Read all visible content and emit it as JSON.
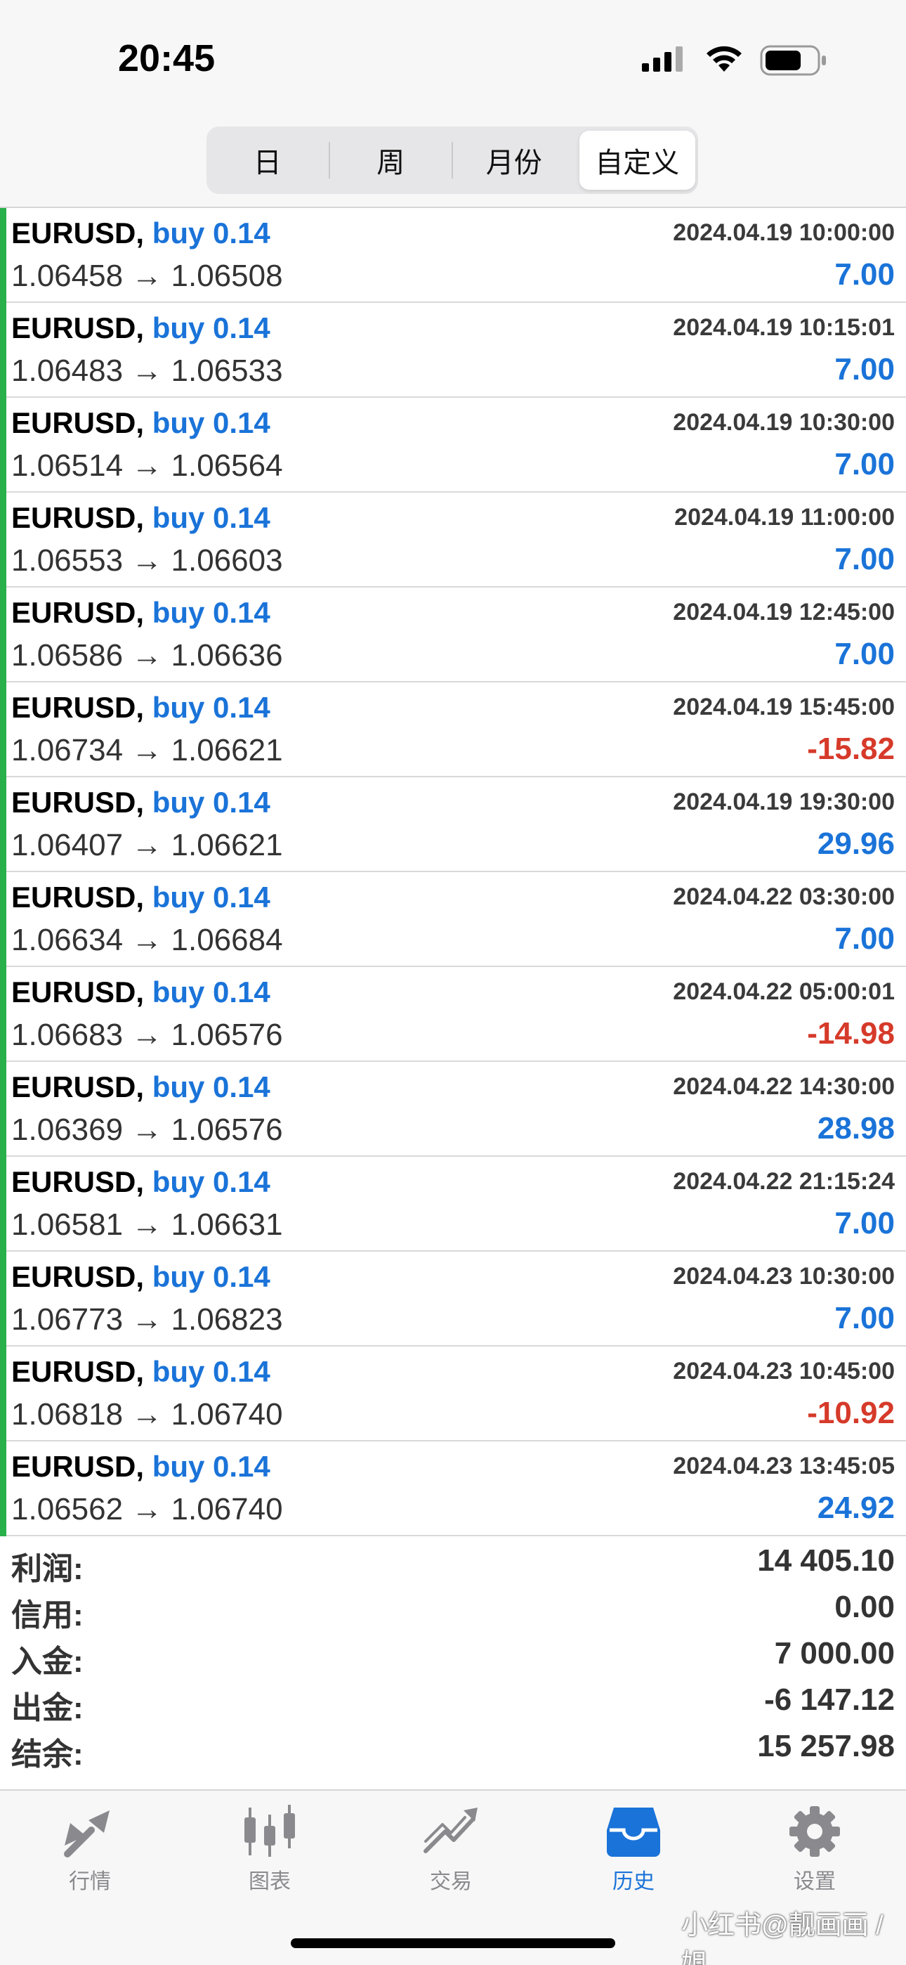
{
  "status": {
    "time": "20:45"
  },
  "segments": [
    {
      "label": "日",
      "active": false
    },
    {
      "label": "周",
      "active": false
    },
    {
      "label": "月份",
      "active": false
    },
    {
      "label": "自定义",
      "active": true
    }
  ],
  "trades": [
    {
      "symbol": "EURUSD,",
      "side": "buy 0.14",
      "time": "2024.04.19 10:00:00",
      "prices": "1.06458 → 1.06508",
      "profit": "7.00",
      "negative": false
    },
    {
      "symbol": "EURUSD,",
      "side": "buy 0.14",
      "time": "2024.04.19 10:15:01",
      "prices": "1.06483 → 1.06533",
      "profit": "7.00",
      "negative": false
    },
    {
      "symbol": "EURUSD,",
      "side": "buy 0.14",
      "time": "2024.04.19 10:30:00",
      "prices": "1.06514 → 1.06564",
      "profit": "7.00",
      "negative": false
    },
    {
      "symbol": "EURUSD,",
      "side": "buy 0.14",
      "time": "2024.04.19 11:00:00",
      "prices": "1.06553 → 1.06603",
      "profit": "7.00",
      "negative": false
    },
    {
      "symbol": "EURUSD,",
      "side": "buy 0.14",
      "time": "2024.04.19 12:45:00",
      "prices": "1.06586 → 1.06636",
      "profit": "7.00",
      "negative": false
    },
    {
      "symbol": "EURUSD,",
      "side": "buy 0.14",
      "time": "2024.04.19 15:45:00",
      "prices": "1.06734 → 1.06621",
      "profit": "-15.82",
      "negative": true
    },
    {
      "symbol": "EURUSD,",
      "side": "buy 0.14",
      "time": "2024.04.19 19:30:00",
      "prices": "1.06407 → 1.06621",
      "profit": "29.96",
      "negative": false
    },
    {
      "symbol": "EURUSD,",
      "side": "buy 0.14",
      "time": "2024.04.22 03:30:00",
      "prices": "1.06634 → 1.06684",
      "profit": "7.00",
      "negative": false
    },
    {
      "symbol": "EURUSD,",
      "side": "buy 0.14",
      "time": "2024.04.22 05:00:01",
      "prices": "1.06683 → 1.06576",
      "profit": "-14.98",
      "negative": true
    },
    {
      "symbol": "EURUSD,",
      "side": "buy 0.14",
      "time": "2024.04.22 14:30:00",
      "prices": "1.06369 → 1.06576",
      "profit": "28.98",
      "negative": false
    },
    {
      "symbol": "EURUSD,",
      "side": "buy 0.14",
      "time": "2024.04.22 21:15:24",
      "prices": "1.06581 → 1.06631",
      "profit": "7.00",
      "negative": false
    },
    {
      "symbol": "EURUSD,",
      "side": "buy 0.14",
      "time": "2024.04.23 10:30:00",
      "prices": "1.06773 → 1.06823",
      "profit": "7.00",
      "negative": false
    },
    {
      "symbol": "EURUSD,",
      "side": "buy 0.14",
      "time": "2024.04.23 10:45:00",
      "prices": "1.06818 → 1.06740",
      "profit": "-10.92",
      "negative": true
    },
    {
      "symbol": "EURUSD,",
      "side": "buy 0.14",
      "time": "2024.04.23 13:45:05",
      "prices": "1.06562 → 1.06740",
      "profit": "24.92",
      "negative": false
    }
  ],
  "summary": [
    {
      "label": "利润:",
      "value": "14 405.10"
    },
    {
      "label": "信用:",
      "value": "0.00"
    },
    {
      "label": "入金:",
      "value": "7 000.00"
    },
    {
      "label": "出金:",
      "value": "-6 147.12"
    },
    {
      "label": "结余:",
      "value": "15 257.98"
    }
  ],
  "tabs": [
    {
      "label": "行情",
      "icon": "quotes-icon",
      "active": false
    },
    {
      "label": "图表",
      "icon": "chart-icon",
      "active": false
    },
    {
      "label": "交易",
      "icon": "trade-icon",
      "active": false
    },
    {
      "label": "历史",
      "icon": "history-icon",
      "active": true
    },
    {
      "label": "设置",
      "icon": "settings-icon",
      "active": false
    }
  ],
  "watermark": "小红书@靓画画 / 姐",
  "colors": {
    "accent": "#1a73d8",
    "negative": "#d63a2a",
    "indicator": "#28b04a"
  }
}
